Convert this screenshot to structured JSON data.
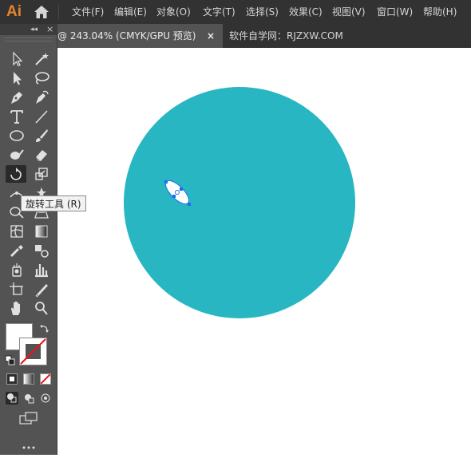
{
  "app": {
    "logo_text": "Ai"
  },
  "menu": [
    "文件(F)",
    "编辑(E)",
    "对象(O)",
    "文字(T)",
    "选择(S)",
    "效果(C)",
    "视图(V)",
    "窗口(W)",
    "帮助(H)"
  ],
  "document_tab": {
    "title": "@ 243.04% (CMYK/GPU 预览)",
    "close_symbol": "×"
  },
  "site_label": "软件自学网：RJZXW.COM",
  "panel": {
    "collapse_symbol": "◂◂",
    "close_symbol": "×"
  },
  "tooltip": {
    "text": "旋转工具 (R)"
  },
  "tools": [
    "selection-tool",
    "direct-selection-tool",
    "group-selection-tool",
    "magic-wand-tool",
    "lasso-tool",
    "pen-tool",
    "curvature-tool",
    "type-tool",
    "line-segment-tool",
    "ellipse-tool",
    "paintbrush-tool",
    "shaper-tool",
    "eraser-tool",
    "rotate-tool",
    "scale-tool",
    "width-tool",
    "free-transform-tool",
    "shape-builder-tool",
    "perspective-grid-tool",
    "mesh-tool",
    "gradient-tool",
    "eyedropper-tool",
    "blend-tool",
    "symbol-sprayer-tool",
    "column-graph-tool",
    "artboard-tool",
    "slice-tool",
    "hand-tool",
    "zoom-tool"
  ],
  "colors": {
    "circle_fill": "#28b7c2",
    "selection_blue": "#1c6ef2",
    "menu_bg": "#323232",
    "panel_bg": "#535353",
    "logo_orange": "#e8842a"
  }
}
